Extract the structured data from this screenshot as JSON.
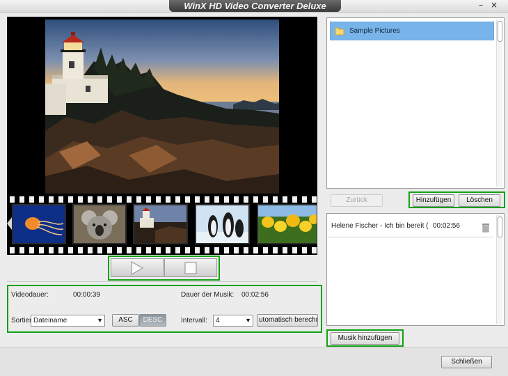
{
  "window": {
    "title": "WinX HD Video Converter Deluxe",
    "minimize_glyph": "–",
    "close_glyph": "×"
  },
  "preview": {
    "image": "lighthouse-sunset-photo"
  },
  "filmstrip": {
    "thumbnails": [
      {
        "name": "jellyfish"
      },
      {
        "name": "koala"
      },
      {
        "name": "lighthouse"
      },
      {
        "name": "penguins"
      },
      {
        "name": "tulips"
      }
    ]
  },
  "transport": {
    "play_icon": "play-icon",
    "stop_icon": "stop-icon"
  },
  "info": {
    "video_duration_label": "Videodauer:",
    "video_duration_value": "00:00:39",
    "music_duration_label": "Dauer der Musik:",
    "music_duration_value": "00:02:56",
    "sort_label": "Sortier",
    "sort_value": "Dateiname",
    "asc_label": "ASC",
    "desc_label": "DESC",
    "interval_label": "Intervall:",
    "interval_value": "4",
    "auto_calc_label": "utomatisch berechne"
  },
  "folders": {
    "items": [
      {
        "label": "Sample Pictures",
        "selected": true
      }
    ],
    "back_label": "Zurück",
    "add_label": "Hinzufügen",
    "delete_label": "Löschen"
  },
  "music": {
    "items": [
      {
        "name": "Helene Fischer - Ich bin bereit (",
        "duration": "00:02:56"
      }
    ],
    "add_music_label": "Musik hinzufügen"
  },
  "footer": {
    "close_label": "Schließen"
  },
  "colors": {
    "highlight": "#13a113",
    "selection": "#78b4ea"
  }
}
